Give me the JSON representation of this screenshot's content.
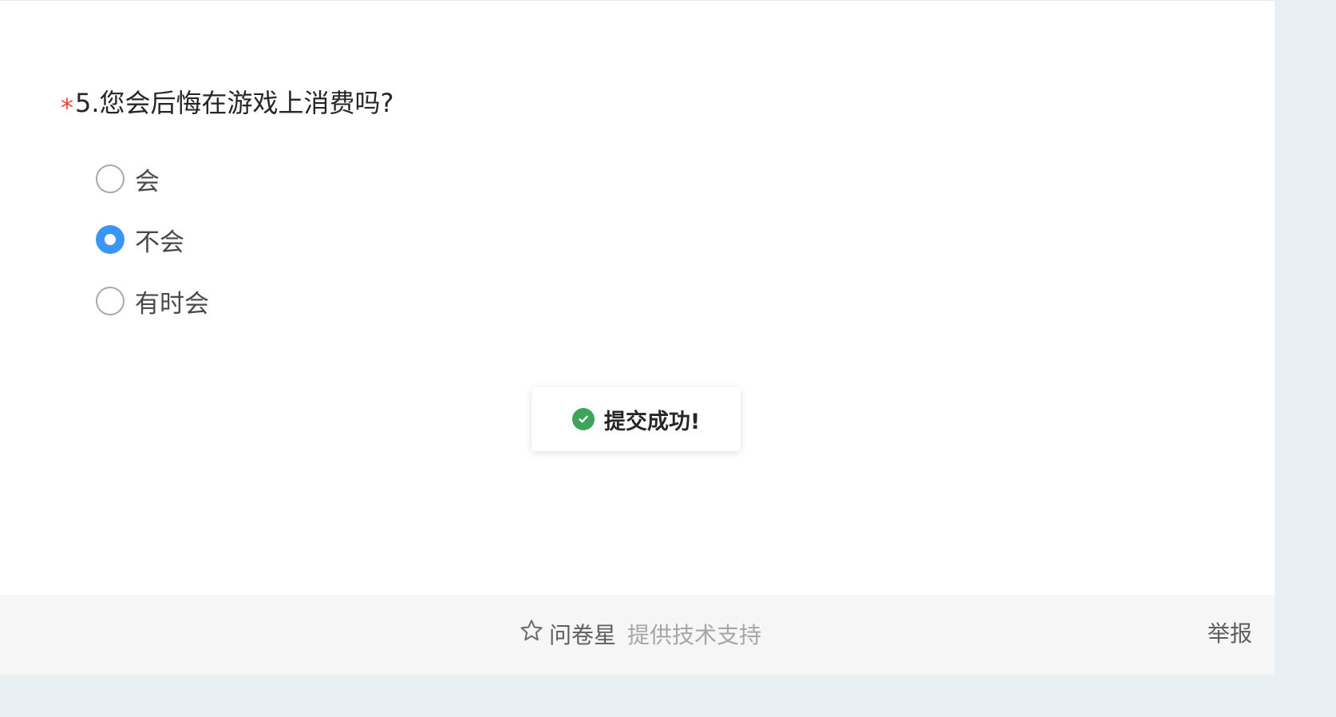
{
  "question": {
    "required_mark": "*",
    "title": "5.您会后悔在游戏上消费吗?",
    "options": [
      {
        "label": "会",
        "checked": false
      },
      {
        "label": "不会",
        "checked": true
      },
      {
        "label": "有时会",
        "checked": false
      }
    ]
  },
  "toast": {
    "icon": "check-circle-icon",
    "message": "提交成功!",
    "icon_color": "#3fa35a"
  },
  "footer": {
    "brand_icon": "star-icon",
    "brand_name": "问卷星",
    "tagline": "提供技术支持",
    "report_label": "举报"
  },
  "colors": {
    "accent": "#3b95f2",
    "required": "#ea4b3c",
    "page_background": "#e9f0f4"
  }
}
